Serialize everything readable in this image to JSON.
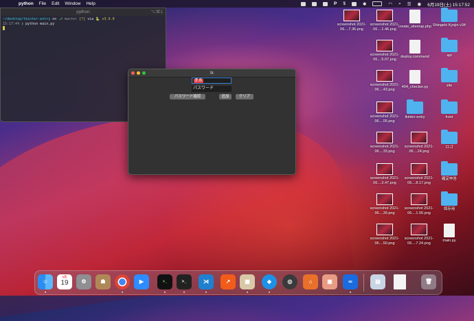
{
  "menubar": {
    "app_name": "python",
    "items": [
      "File",
      "Edit",
      "Window",
      "Help"
    ],
    "status": {
      "date_time": "6月19日(土) 15:17:52"
    }
  },
  "terminal": {
    "title": "python",
    "shortcut": "⌥⌘1",
    "line1": {
      "path": "~/desktop/tkinter-entry",
      "on": "on",
      "branch": "master",
      "flags": "[?]",
      "via": "via",
      "version": "v3.9.0"
    },
    "line2": {
      "time": "15:17:44",
      "prompt": "❯",
      "command": "python main.py"
    }
  },
  "tk_window": {
    "title": "tk",
    "entry1_value": "赤系",
    "entry2_value": "パスワード",
    "buttons": [
      "パスワード確認",
      "追加",
      "クリア"
    ]
  },
  "desktop": {
    "icons": [
      {
        "label": "screenshot 2021-06....7.36.png",
        "kind": "thumb"
      },
      {
        "label": "screenshot 2021-06....1.46.png",
        "kind": "thumb"
      },
      {
        "label": "create_sitemap.php",
        "kind": "doc"
      },
      {
        "label": "Shingeki Kyojin v34",
        "kind": "folder"
      },
      {
        "label": "screenshot 2021-06....5.07.png",
        "kind": "thumb"
      },
      {
        "label": "deploy.command",
        "kind": "doc"
      },
      {
        "label": "api",
        "kind": "folder"
      },
      {
        "label": "screenshot 2021-06....43.png",
        "kind": "thumb"
      },
      {
        "label": "404_checker.py",
        "kind": "doc"
      },
      {
        "label": "site",
        "kind": "folder"
      },
      {
        "label": "screenshot 2021-06....05.png",
        "kind": "thumb"
      },
      {
        "label": "tkinter-entry",
        "kind": "folder"
      },
      {
        "label": "front",
        "kind": "folder"
      },
      {
        "label": "screenshot 2021-06....33.png",
        "kind": "thumb"
      },
      {
        "label": "screenshot 2021-06....24.png",
        "kind": "thumb"
      },
      {
        "label": "ロゴ",
        "kind": "folder"
      },
      {
        "label": "screenshot 2021-06....3.47.png",
        "kind": "thumb"
      },
      {
        "label": "screenshot 2021-06....8.17.png",
        "kind": "thumb"
      },
      {
        "label": "確定申告",
        "kind": "folder"
      },
      {
        "label": "screenshot 2021-06....39.png",
        "kind": "thumb"
      },
      {
        "label": "screenshot 2021-06....1.00.png",
        "kind": "thumb"
      },
      {
        "label": "保存用",
        "kind": "folder"
      },
      {
        "label": "screenshot 2021-06....50.png",
        "kind": "thumb"
      },
      {
        "label": "screenshot 2021-06....7.24.png",
        "kind": "thumb"
      },
      {
        "label": "main.py",
        "kind": "doc"
      }
    ]
  },
  "dock": {
    "calendar_month": "6月",
    "calendar_day": "19",
    "apps": [
      "finder-icon",
      "calendar-icon",
      "system-preferences-icon",
      "contacts-icon",
      "chrome-icon",
      "zoom-icon",
      "terminal-icon",
      "terminal-icon",
      "vscode-icon",
      "monitor-icon",
      "docker-image-icon",
      "docker-icon",
      "quicktime-icon",
      "sourcetree-icon",
      "preview-icon",
      "infinity-icon",
      "downloads-icon",
      "document-icon",
      "trash-icon"
    ]
  }
}
